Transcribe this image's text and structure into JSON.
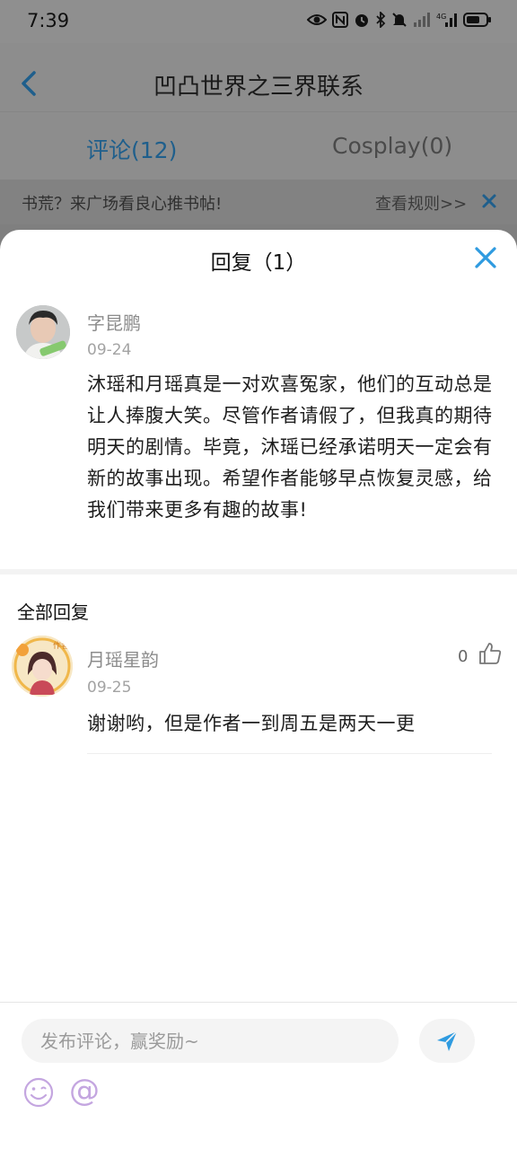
{
  "status_bar": {
    "time": "7:39"
  },
  "header": {
    "title": "凹凸世界之三界联系",
    "tabs": [
      {
        "label": "评论(12)"
      },
      {
        "label": "Cosplay(0)"
      }
    ]
  },
  "notice": {
    "text": "书荒？来广场看良心推书帖!",
    "link": "查看规则>>"
  },
  "sheet": {
    "title": "回复（1）",
    "comment": {
      "username": "字昆鹏",
      "date": "09-24",
      "body": "沐瑶和月瑶真是一对欢喜冤家，他们的互动总是让人捧腹大笑。尽管作者请假了，但我真的期待明天的剧情。毕竟，沐瑶已经承诺明天一定会有新的故事出现。希望作者能够早点恢复灵感，给我们带来更多有趣的故事!"
    },
    "replies_heading": "全部回复",
    "replies": [
      {
        "username": "月瑶星韵",
        "date": "09-25",
        "text": "谢谢哟，但是作者一到周五是两天一更",
        "likes": "0"
      }
    ]
  },
  "composer": {
    "placeholder": "发布评论，赢奖励~",
    "mention_symbol": "@"
  },
  "colors": {
    "accent": "#2f9be0",
    "overlay_gray": "#8d8d8d",
    "mention": "#c4a6e0"
  }
}
